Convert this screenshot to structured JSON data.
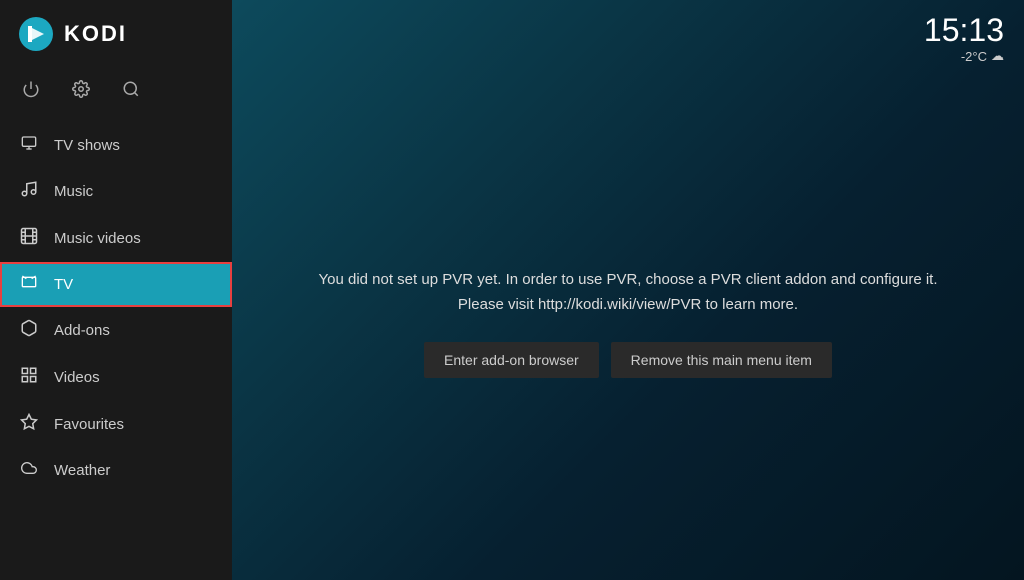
{
  "sidebar": {
    "logo_text": "KODI",
    "nav_items": [
      {
        "id": "tv-shows",
        "label": "TV shows",
        "icon": "tv",
        "active": false
      },
      {
        "id": "music",
        "label": "Music",
        "icon": "music",
        "active": false
      },
      {
        "id": "music-videos",
        "label": "Music videos",
        "icon": "film",
        "active": false
      },
      {
        "id": "tv",
        "label": "TV",
        "icon": "monitor",
        "active": true
      },
      {
        "id": "add-ons",
        "label": "Add-ons",
        "icon": "box",
        "active": false
      },
      {
        "id": "videos",
        "label": "Videos",
        "icon": "grid",
        "active": false
      },
      {
        "id": "favourites",
        "label": "Favourites",
        "icon": "star",
        "active": false
      },
      {
        "id": "weather",
        "label": "Weather",
        "icon": "cloud",
        "active": false
      }
    ]
  },
  "topbar": {
    "time": "15:13",
    "temperature": "-2°C",
    "weather_icon": "☁"
  },
  "pvr_section": {
    "message_line1": "You did not set up PVR yet. In order to use PVR, choose a PVR client addon and configure it.",
    "message_line2": "Please visit http://kodi.wiki/view/PVR to learn more.",
    "btn_addon_browser": "Enter add-on browser",
    "btn_remove_menu": "Remove this main menu item"
  }
}
